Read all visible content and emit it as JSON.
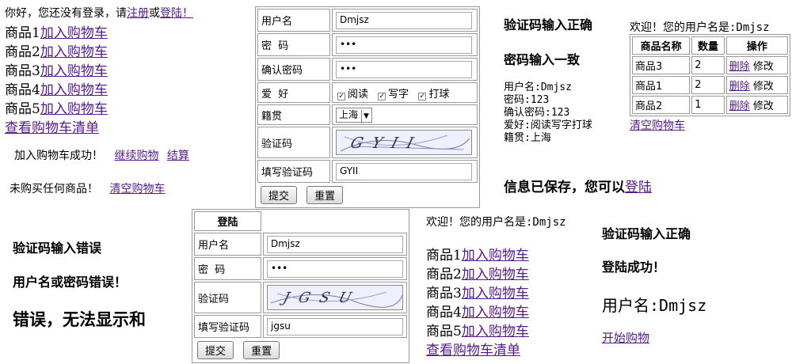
{
  "panel1": {
    "greeting_prefix": "你好，您还没有登录，请",
    "register_link": "注册",
    "or_text": "或",
    "login_link": "登陆",
    "greeting_suffix": "！",
    "products": [
      {
        "name": "商品1",
        "add": "加入购物车"
      },
      {
        "name": "商品2",
        "add": "加入购物车"
      },
      {
        "name": "商品3",
        "add": "加入购物车"
      },
      {
        "name": "商品4",
        "add": "加入购物车"
      },
      {
        "name": "商品5",
        "add": "加入购物车"
      }
    ],
    "view_cart": "查看购物车清单",
    "added_msg": "加入购物车成功！",
    "continue_link": "继续购物",
    "checkout_link": "结算",
    "nothing_msg": "未购买任何商品！",
    "clear_link": "清空购物车"
  },
  "register_form": {
    "username_label": "用户名",
    "username_value": "Dmjsz",
    "password_label": "密  码",
    "password_value": "•••",
    "confirm_label": "确认密码",
    "confirm_value": "•••",
    "hobby_label": "爱  好",
    "hobbies": [
      "阅读",
      "写字",
      "打球"
    ],
    "origin_label": "籍贯",
    "origin_value": "上海",
    "captcha_label": "验证码",
    "captcha_text": "GYII",
    "fill_captcha_label": "填写验证码",
    "fill_captcha_value": "GYII",
    "submit": "提交",
    "reset": "重置"
  },
  "register_result": {
    "captcha_ok": "验证码输入正确",
    "password_match": "密码输入一致",
    "lines": [
      "用户名:Dmjsz",
      "密码:123",
      "确认密码:123",
      "爱好:阅读写字打球",
      "籍贯:上海"
    ],
    "saved_prefix": "信息已保存，您可以",
    "login_link": "登陆"
  },
  "cart": {
    "welcome": "欢迎！您的用户名是:Dmjsz",
    "headers": [
      "商品名称",
      "数量",
      "操作"
    ],
    "rows": [
      {
        "name": "商品3",
        "qty": "2",
        "delete": "删除",
        "edit": "修改"
      },
      {
        "name": "商品1",
        "qty": "2",
        "delete": "删除",
        "edit": "修改"
      },
      {
        "name": "商品2",
        "qty": "1",
        "delete": "删除",
        "edit": "修改"
      }
    ],
    "clear_link": "清空购物车"
  },
  "errors": {
    "captcha_wrong": "验证码输入错误",
    "user_or_pwd_wrong": "用户名或密码错误！",
    "cannot_display": "错误，无法显示和"
  },
  "login_form": {
    "title": "登陆",
    "username_label": "用户名",
    "username_value": "Dmjsz",
    "password_label": "密  码",
    "password_value": "•••",
    "captcha_label": "验证码",
    "captcha_text": "JGSU",
    "fill_captcha_label": "填写验证码",
    "fill_captcha_value": "jgsu",
    "submit": "提交",
    "reset": "重置"
  },
  "panel_shop2": {
    "welcome": "欢迎！您的用户名是:Dmjsz",
    "products": [
      {
        "name": "商品1",
        "add": "加入购物车"
      },
      {
        "name": "商品2",
        "add": "加入购物车"
      },
      {
        "name": "商品3",
        "add": "加入购物车"
      },
      {
        "name": "商品4",
        "add": "加入购物车"
      },
      {
        "name": "商品5",
        "add": "加入购物车"
      }
    ],
    "view_cart": "查看购物车清单"
  },
  "login_result": {
    "captcha_ok": "验证码输入正确",
    "login_success": "登陆成功！",
    "username_line": "用户名:Dmjsz",
    "start_shopping": "开始购物"
  }
}
